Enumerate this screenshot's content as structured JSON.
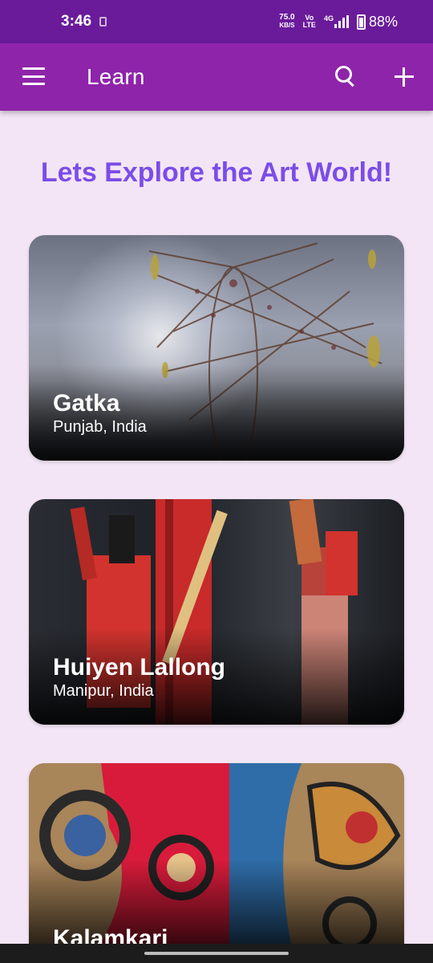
{
  "status_bar": {
    "time": "3:46",
    "net_speed_value": "75.0",
    "net_speed_unit": "KB/S",
    "volte_top": "Vo",
    "volte_bottom": "LTE",
    "network": "4G",
    "battery": "88%"
  },
  "app_bar": {
    "title": "Learn"
  },
  "headline": "Lets Explore the Art World!",
  "cards": [
    {
      "name": "Gatka",
      "location": "Punjab, India"
    },
    {
      "name": "Huiyen Lallong",
      "location": "Manipur, India"
    },
    {
      "name": "Kalamkari",
      "location": ""
    }
  ],
  "colors": {
    "status_bar": "#6a1b9a",
    "app_bar": "#8e24aa",
    "background": "#f3e5f5",
    "headline": "#7b4de8"
  }
}
